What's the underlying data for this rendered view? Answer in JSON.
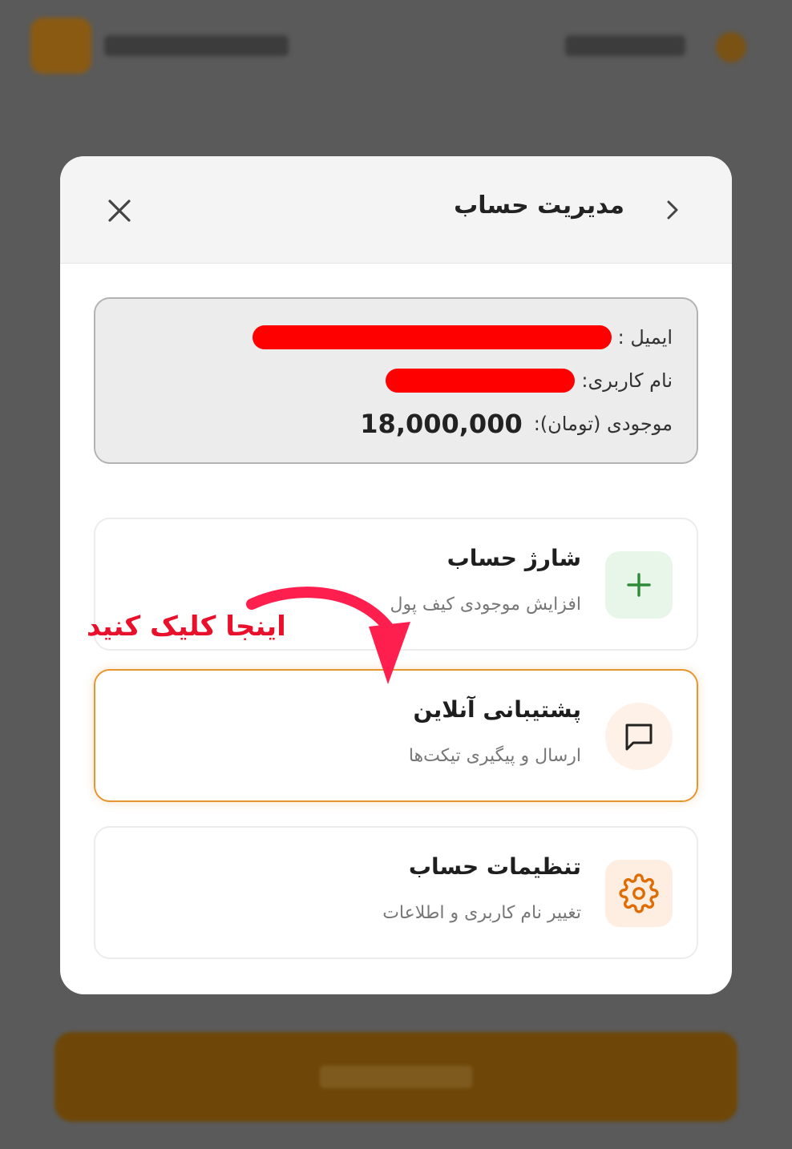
{
  "modal": {
    "title": "مدیریت حساب"
  },
  "account": {
    "email_label": "ایمیل :",
    "username_label": "نام کاربری:",
    "balance_label": "موجودی (تومان):",
    "balance_value": "18,000,000"
  },
  "options": [
    {
      "title": "شارژ حساب",
      "subtitle": "افزایش موجودی کیف پول",
      "icon": "plus-icon",
      "icon_color": "#2e8b3a",
      "icon_bg": "#e8f5e9"
    },
    {
      "title": "پشتیبانی آنلاین",
      "subtitle": "ارسال و پیگیری تیکت‌ها",
      "icon": "chat-bubble-icon",
      "icon_color": "#222222",
      "icon_bg": "#fdf1e8"
    },
    {
      "title": "تنظیمات حساب",
      "subtitle": "تغییر نام کاربری و اطلاعات",
      "icon": "gear-icon",
      "icon_color": "#e06b00",
      "icon_bg": "#fdeee1"
    }
  ],
  "annotation": {
    "text": "اینجا کلیک کنید",
    "color": "#e8102a"
  },
  "colors": {
    "highlight_border": "#e9952f",
    "redaction": "#ff0000"
  }
}
